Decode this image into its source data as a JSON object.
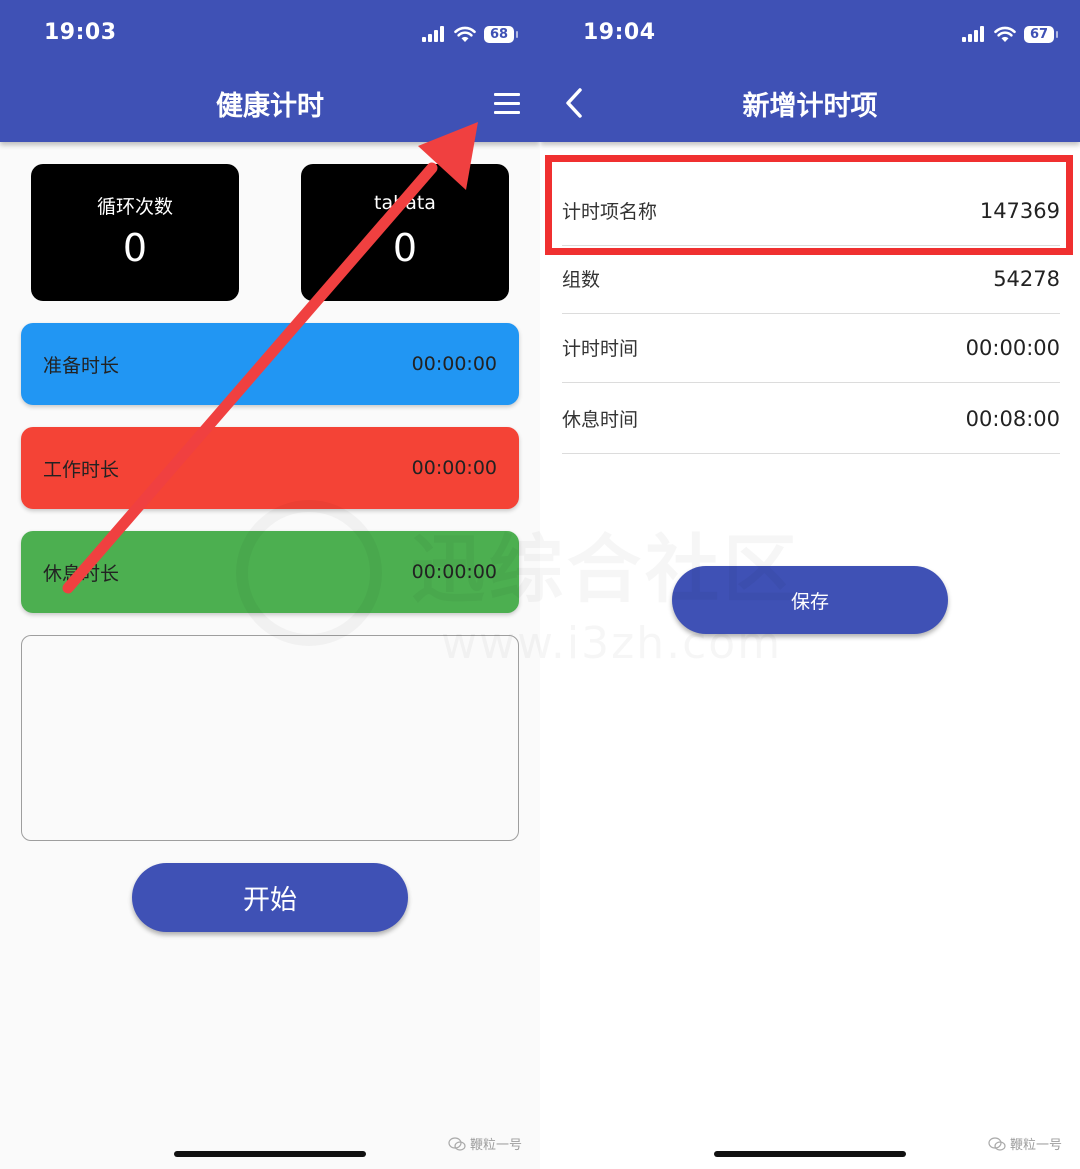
{
  "left": {
    "status": {
      "time": "19:03",
      "battery": "68"
    },
    "appbar": {
      "title": "健康计时"
    },
    "stats": [
      {
        "label": "循环次数",
        "value": "0"
      },
      {
        "label": "tabata",
        "value": "0"
      }
    ],
    "phases": [
      {
        "label": "准备时长",
        "time": "00:00:00",
        "color": "#2196f3"
      },
      {
        "label": "工作时长",
        "time": "00:00:00",
        "color": "#f44336"
      },
      {
        "label": "休息时长",
        "time": "00:00:00",
        "color": "#4caf50"
      }
    ],
    "start_label": "开始",
    "watermark": "鞭粒一号"
  },
  "right": {
    "status": {
      "time": "19:04",
      "battery": "67"
    },
    "appbar": {
      "title": "新增计时项"
    },
    "form": [
      {
        "label": "计时项名称",
        "value": "147369"
      },
      {
        "label": "组数",
        "value": "54278"
      },
      {
        "label": "计时时间",
        "value": "00:00:00"
      },
      {
        "label": "休息时间",
        "value": "00:08:00"
      }
    ],
    "save_label": "保存",
    "watermark": "鞭粒一号"
  },
  "background_watermark": {
    "text": "迅综合社区",
    "url": "www.i3zh.com"
  },
  "colors": {
    "primary": "#3f51b5",
    "highlight": "#f03030",
    "arrow": "#f04040"
  }
}
